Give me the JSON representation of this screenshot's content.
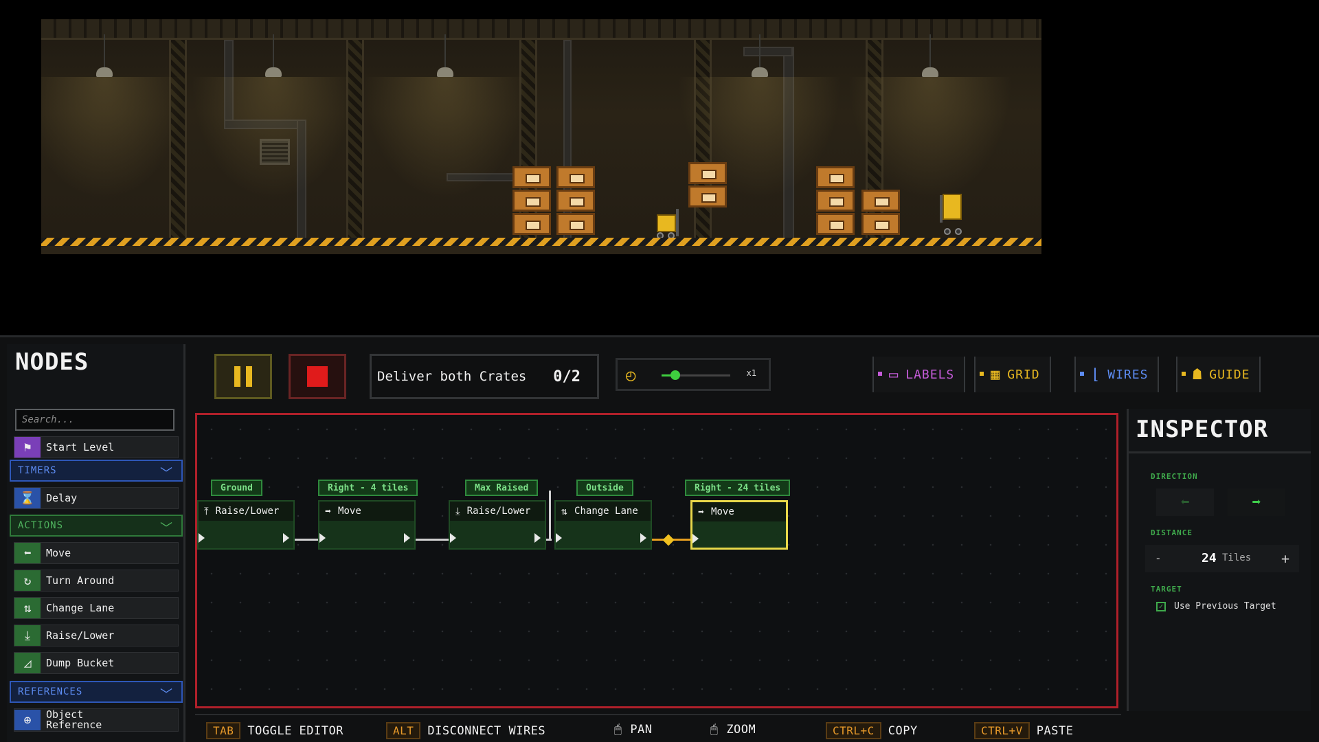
{
  "nodes_panel": {
    "title": "NODES",
    "search_placeholder": "Search...",
    "start_item": {
      "label": "Start Level",
      "icon": "flag-icon"
    },
    "categories": [
      {
        "label": "TIMERS",
        "items": [
          {
            "label": "Delay",
            "icon": "hourglass-icon"
          }
        ]
      },
      {
        "label": "ACTIONS",
        "items": [
          {
            "label": "Move",
            "icon": "arrow-left-icon"
          },
          {
            "label": "Turn Around",
            "icon": "turn-around-icon"
          },
          {
            "label": "Change Lane",
            "icon": "change-lane-icon"
          },
          {
            "label": "Raise/Lower",
            "icon": "raise-lower-icon"
          },
          {
            "label": "Dump Bucket",
            "icon": "dump-bucket-icon"
          }
        ]
      },
      {
        "label": "REFERENCES",
        "items": [
          {
            "label": "Object\nReference",
            "icon": "crosshair-icon"
          }
        ]
      }
    ]
  },
  "toolbar": {
    "objective": "Deliver both Crates",
    "objective_count": "0/2",
    "objective_progress": 0,
    "speed_label": "x1",
    "speed_fraction": 0.2,
    "toggles": {
      "labels": "LABELS",
      "grid": "GRID",
      "wires": "WIRES",
      "guide": "GUIDE"
    }
  },
  "graph": {
    "nodes": [
      {
        "label": "Ground",
        "title": "Raise/Lower",
        "icon": "raise-icon"
      },
      {
        "label": "Right - 4 tiles",
        "title": "Move",
        "icon": "arrow-right-icon"
      },
      {
        "label": "Max Raised",
        "title": "Raise/Lower",
        "icon": "lower-icon"
      },
      {
        "label": "Outside",
        "title": "Change Lane",
        "icon": "change-lane-icon"
      },
      {
        "label": "Right - 24 tiles",
        "title": "Move",
        "icon": "arrow-right-icon",
        "selected": true
      }
    ]
  },
  "inspector": {
    "title": "INSPECTOR",
    "direction_label": "DIRECTION",
    "direction_selected": "right",
    "distance_label": "DISTANCE",
    "distance_value": "24",
    "distance_unit": "Tiles",
    "distance_minus": "-",
    "distance_plus": "+",
    "target_label": "TARGET",
    "use_previous_target": "Use Previous Target",
    "use_previous_checked": true
  },
  "hints": [
    {
      "key": "TAB",
      "action": "TOGGLE EDITOR"
    },
    {
      "key": "ALT",
      "action": "DISCONNECT WIRES"
    },
    {
      "mouse": "mouse-drag-icon",
      "action": "PAN"
    },
    {
      "mouse": "mouse-scroll-icon",
      "action": "ZOOM"
    },
    {
      "key": "CTRL+C",
      "action": "COPY"
    },
    {
      "key": "CTRL+V",
      "action": "PASTE"
    }
  ],
  "colors": {
    "canvas_border": "#b0202a",
    "node_green": "#2f8a3d",
    "selection": "#e8d84a",
    "accent_yellow": "#e8b820",
    "accent_blue": "#5d8cf2",
    "accent_purple": "#c45bd8"
  }
}
